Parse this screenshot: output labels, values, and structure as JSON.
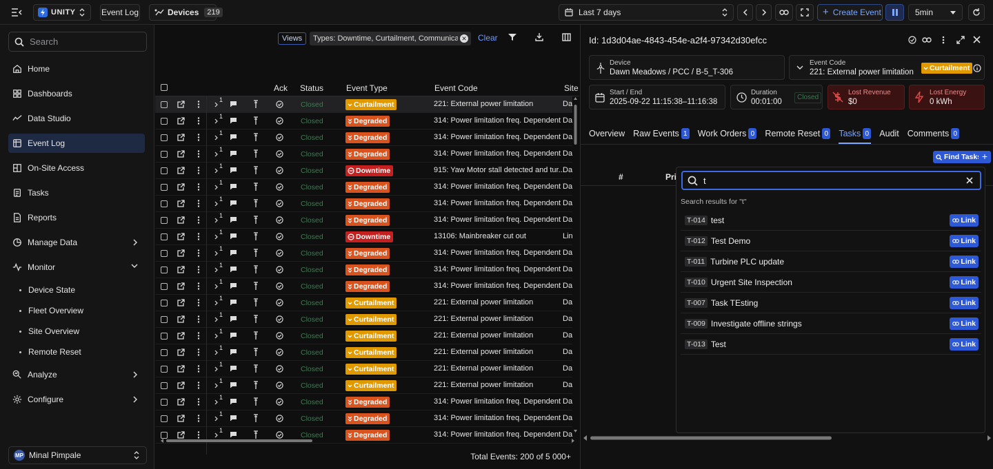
{
  "topbar": {
    "brand": "UNITY",
    "page_label": "Event Log",
    "devices_label": "Devices",
    "devices_count": "219",
    "time_range": "Last 7 days",
    "create_event": "Create Event",
    "refresh_interval": "5min"
  },
  "sidebar": {
    "search_placeholder": "Search",
    "items": [
      {
        "label": "Home",
        "icon": "home-icon"
      },
      {
        "label": "Dashboards",
        "icon": "dashboard-icon"
      },
      {
        "label": "Data Studio",
        "icon": "chart-line-icon"
      },
      {
        "label": "Event Log",
        "icon": "event-log-icon"
      },
      {
        "label": "On-Site Access",
        "icon": "building-icon"
      },
      {
        "label": "Tasks",
        "icon": "tasks-icon"
      },
      {
        "label": "Reports",
        "icon": "report-icon"
      },
      {
        "label": "Manage Data",
        "icon": "manage-data-icon"
      },
      {
        "label": "Monitor",
        "icon": "monitor-icon"
      },
      {
        "label": "Analyze",
        "icon": "analyze-icon"
      },
      {
        "label": "Configure",
        "icon": "gear-icon"
      }
    ],
    "monitor_sub": [
      "Device State",
      "Fleet Overview",
      "Site Overview",
      "Remote Reset"
    ],
    "user_initials": "MP",
    "user_name": "Minal Pimpale"
  },
  "filters": {
    "views": "Views",
    "chip": "Types: Downtime, Curtailment, Communicat...",
    "clear": "Clear"
  },
  "table": {
    "headers": {
      "ack": "Ack",
      "status": "Status",
      "event_type": "Event Type",
      "event_code": "Event Code",
      "site": "Site"
    },
    "rows": [
      {
        "badge": "1",
        "status": "Closed",
        "type": "Curtailment",
        "code": "221: External power limitation",
        "site": "Da"
      },
      {
        "badge": "1",
        "status": "Closed",
        "type": "Degraded",
        "code": "314: Power limitation freq. Dependent",
        "site": "Da"
      },
      {
        "badge": "1",
        "status": "Closed",
        "type": "Degraded",
        "code": "314: Power limitation freq. Dependent",
        "site": "Da"
      },
      {
        "badge": "1",
        "status": "Closed",
        "type": "Degraded",
        "code": "314: Power limitation freq. Dependent",
        "site": "Da"
      },
      {
        "badge": "1",
        "status": "Closed",
        "type": "Downtime",
        "code": "915: Yaw Motor stall detected and tur...",
        "site": "Da"
      },
      {
        "badge": "1",
        "status": "Closed",
        "type": "Degraded",
        "code": "314: Power limitation freq. Dependent",
        "site": "Da"
      },
      {
        "badge": "1",
        "status": "Closed",
        "type": "Degraded",
        "code": "314: Power limitation freq. Dependent",
        "site": "Da"
      },
      {
        "badge": "1",
        "status": "Closed",
        "type": "Degraded",
        "code": "314: Power limitation freq. Dependent",
        "site": "Da"
      },
      {
        "badge": "1",
        "status": "Closed",
        "type": "Downtime",
        "code": "13106: Mainbreaker cut out",
        "site": "Lin"
      },
      {
        "badge": "1",
        "status": "Closed",
        "type": "Degraded",
        "code": "314: Power limitation freq. Dependent",
        "site": "Da"
      },
      {
        "badge": "1",
        "status": "Closed",
        "type": "Degraded",
        "code": "314: Power limitation freq. Dependent",
        "site": "Da"
      },
      {
        "badge": "1",
        "status": "Closed",
        "type": "Degraded",
        "code": "314: Power limitation freq. Dependent",
        "site": "Da"
      },
      {
        "badge": "1",
        "status": "Closed",
        "type": "Curtailment",
        "code": "221: External power limitation",
        "site": "Da"
      },
      {
        "badge": "1",
        "status": "Closed",
        "type": "Curtailment",
        "code": "221: External power limitation",
        "site": "Da"
      },
      {
        "badge": "1",
        "status": "Closed",
        "type": "Curtailment",
        "code": "221: External power limitation",
        "site": "Da"
      },
      {
        "badge": "1",
        "status": "Closed",
        "type": "Curtailment",
        "code": "221: External power limitation",
        "site": "Da"
      },
      {
        "badge": "1",
        "status": "Closed",
        "type": "Curtailment",
        "code": "221: External power limitation",
        "site": "Da"
      },
      {
        "badge": "1",
        "status": "Closed",
        "type": "Curtailment",
        "code": "221: External power limitation",
        "site": "Da"
      },
      {
        "badge": "1",
        "status": "Closed",
        "type": "Degraded",
        "code": "314: Power limitation freq. Dependent",
        "site": "Da"
      },
      {
        "badge": "1",
        "status": "Closed",
        "type": "Degraded",
        "code": "314: Power limitation freq. Dependent",
        "site": "Da"
      },
      {
        "badge": "1",
        "status": "Closed",
        "type": "Degraded",
        "code": "314: Power limitation freq. Dependent",
        "site": "Da"
      }
    ],
    "total": "Total Events: 200 of 5 000+"
  },
  "detail": {
    "id": "Id: 1d3d04ae-4843-454e-a2f4-97342d30efcc",
    "device_label": "Device",
    "device_value": "Dawn Meadows / PCC / B-5_T-306",
    "code_label": "Event Code",
    "code_value": "221: External power limitation",
    "code_badge": "Curtailment",
    "start_label": "Start / End",
    "start_value": "2025-09-22 11:15:38–11:16:38",
    "duration_label": "Duration",
    "duration_value": "00:01:00",
    "duration_status": "Closed",
    "revenue_label": "Lost Revenue",
    "revenue_value": "$0",
    "energy_label": "Lost Energy",
    "energy_value": "0 kWh",
    "tabs": [
      {
        "label": "Overview",
        "count": ""
      },
      {
        "label": "Raw Events",
        "count": "1"
      },
      {
        "label": "Work Orders",
        "count": "0"
      },
      {
        "label": "Remote Reset",
        "count": "0"
      },
      {
        "label": "Tasks",
        "count": "0"
      },
      {
        "label": "Audit",
        "count": ""
      },
      {
        "label": "Comments",
        "count": "0"
      }
    ],
    "find_tasks": "Find Tasks",
    "col_hash": "#",
    "col_pri": "Pri"
  },
  "popup": {
    "query": "t",
    "results_label": "Search results for \"t\"",
    "link_label": "Link",
    "tasks": [
      {
        "id": "T-014",
        "name": "test"
      },
      {
        "id": "T-012",
        "name": "Test Demo"
      },
      {
        "id": "T-011",
        "name": "Turbine PLC update"
      },
      {
        "id": "T-010",
        "name": "Urgent Site Inspection"
      },
      {
        "id": "T-007",
        "name": "Task TEsting"
      },
      {
        "id": "T-009",
        "name": "Investigate offline strings"
      },
      {
        "id": "T-013",
        "name": "Test"
      }
    ]
  },
  "colors": {
    "accent": "#2d58d6",
    "curtailment": "#e09a00",
    "degraded": "#d9531e",
    "downtime": "#c42020",
    "closed": "#3d7a52"
  }
}
